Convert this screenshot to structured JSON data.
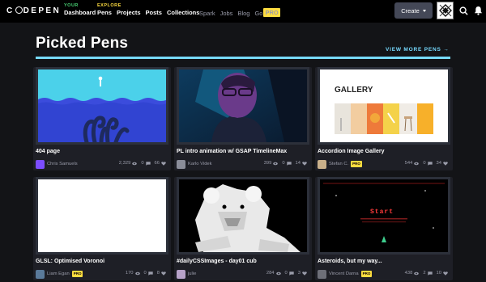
{
  "header": {
    "logo_left": "C",
    "logo_right": "DEPEN",
    "dashboard_group_label": "YOUR",
    "dashboard_label": "Dashboard",
    "explore_group_label": "EXPLORE",
    "explore_items": [
      "Pens",
      "Projects",
      "Posts",
      "Collections"
    ],
    "secondary_items": [
      "Spark",
      "Jobs",
      "Blog",
      "Go"
    ],
    "pro_badge": "PRO",
    "create_label": "Create",
    "icons": [
      "search-icon",
      "bell-icon",
      "chevron-down-icon"
    ]
  },
  "section": {
    "title": "Picked Pens",
    "view_more": "VIEW MORE PENS →"
  },
  "colors": {
    "accent": "#76daff",
    "pro": "#ffdd40",
    "your": "#47cf73",
    "background": "#131417",
    "card": "#1e1f26"
  },
  "cards": [
    {
      "title": "404 page",
      "author": "Chris Samuels",
      "pro": false,
      "views": "2,329",
      "comments": "0",
      "hearts": "66"
    },
    {
      "title": "PL intro animation w/ GSAP TimelineMax",
      "author": "Karlo Videk",
      "pro": false,
      "views": "399",
      "comments": "0",
      "hearts": "14"
    },
    {
      "title": "Accordion Image Gallery",
      "author": "Stefan C.",
      "pro": true,
      "views": "544",
      "comments": "0",
      "hearts": "34",
      "thumb_text": "GALLERY"
    },
    {
      "title": "GLSL: Optimised Voronoi",
      "author": "Liam Egan",
      "pro": true,
      "views": "170",
      "comments": "0",
      "hearts": "8"
    },
    {
      "title": "#dailyCSSImages - day01 cub",
      "author": "julie",
      "pro": false,
      "views": "284",
      "comments": "0",
      "hearts": "3"
    },
    {
      "title": "Asteroids, but my way...",
      "author": "Vincent Darna",
      "pro": true,
      "views": "438",
      "comments": "2",
      "hearts": "10",
      "thumb_text": "Start"
    }
  ]
}
